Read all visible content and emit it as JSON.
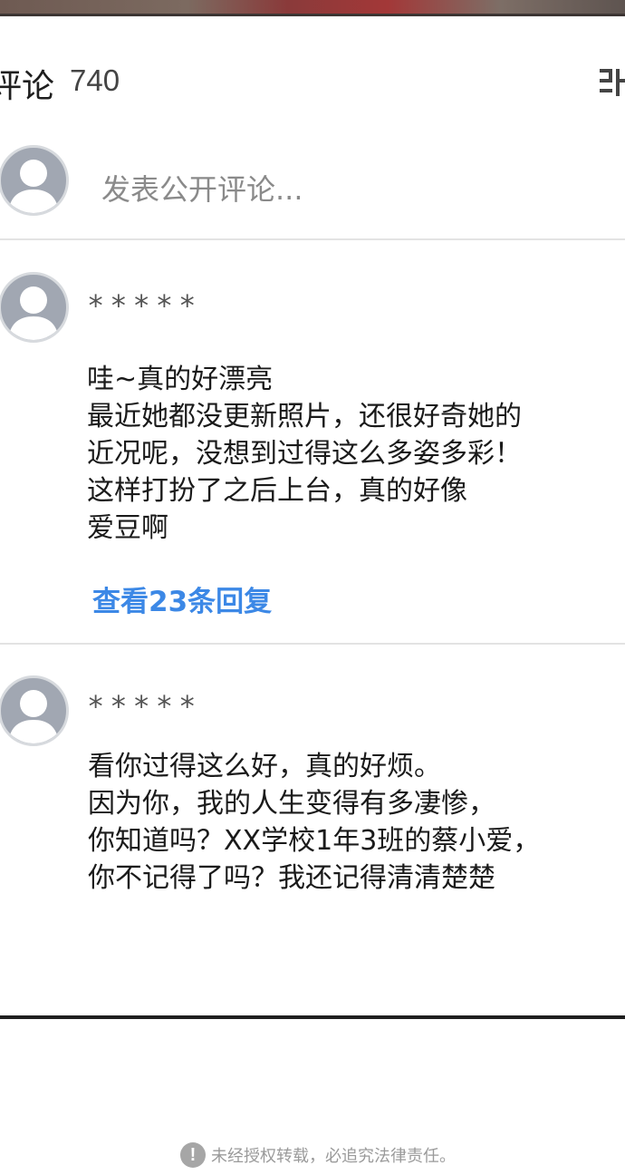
{
  "comments_header": {
    "title": "评论",
    "count": "740",
    "sort_icon": "sort-icon"
  },
  "composer": {
    "placeholder": "发表公开评论...",
    "avatar_icon": "default-user-icon"
  },
  "comments": [
    {
      "username": "*****",
      "lines": [
        "哇~真的好漂亮",
        "最近她都没更新照片，还很好奇她的",
        "近况呢，没想到过得这么多姿多彩！",
        "这样打扮了之后上台，真的好像",
        "爱豆啊"
      ],
      "view_replies": "查看23条回复"
    },
    {
      "username": "*****",
      "lines": [
        "看你过得这么好，真的好烦。",
        "因为你，我的人生变得有多凄惨，",
        "你知道吗？XX学校1年3班的蔡小爱，",
        "你不记得了吗？我还记得清清楚楚"
      ]
    }
  ],
  "footer": {
    "notice": "未经授权转载，必追究法律责任。",
    "notice_icon": "exclamation-icon"
  },
  "colors": {
    "link": "#3c88e6",
    "avatar": "#a1a7b2",
    "border": "#1f1f1f"
  }
}
